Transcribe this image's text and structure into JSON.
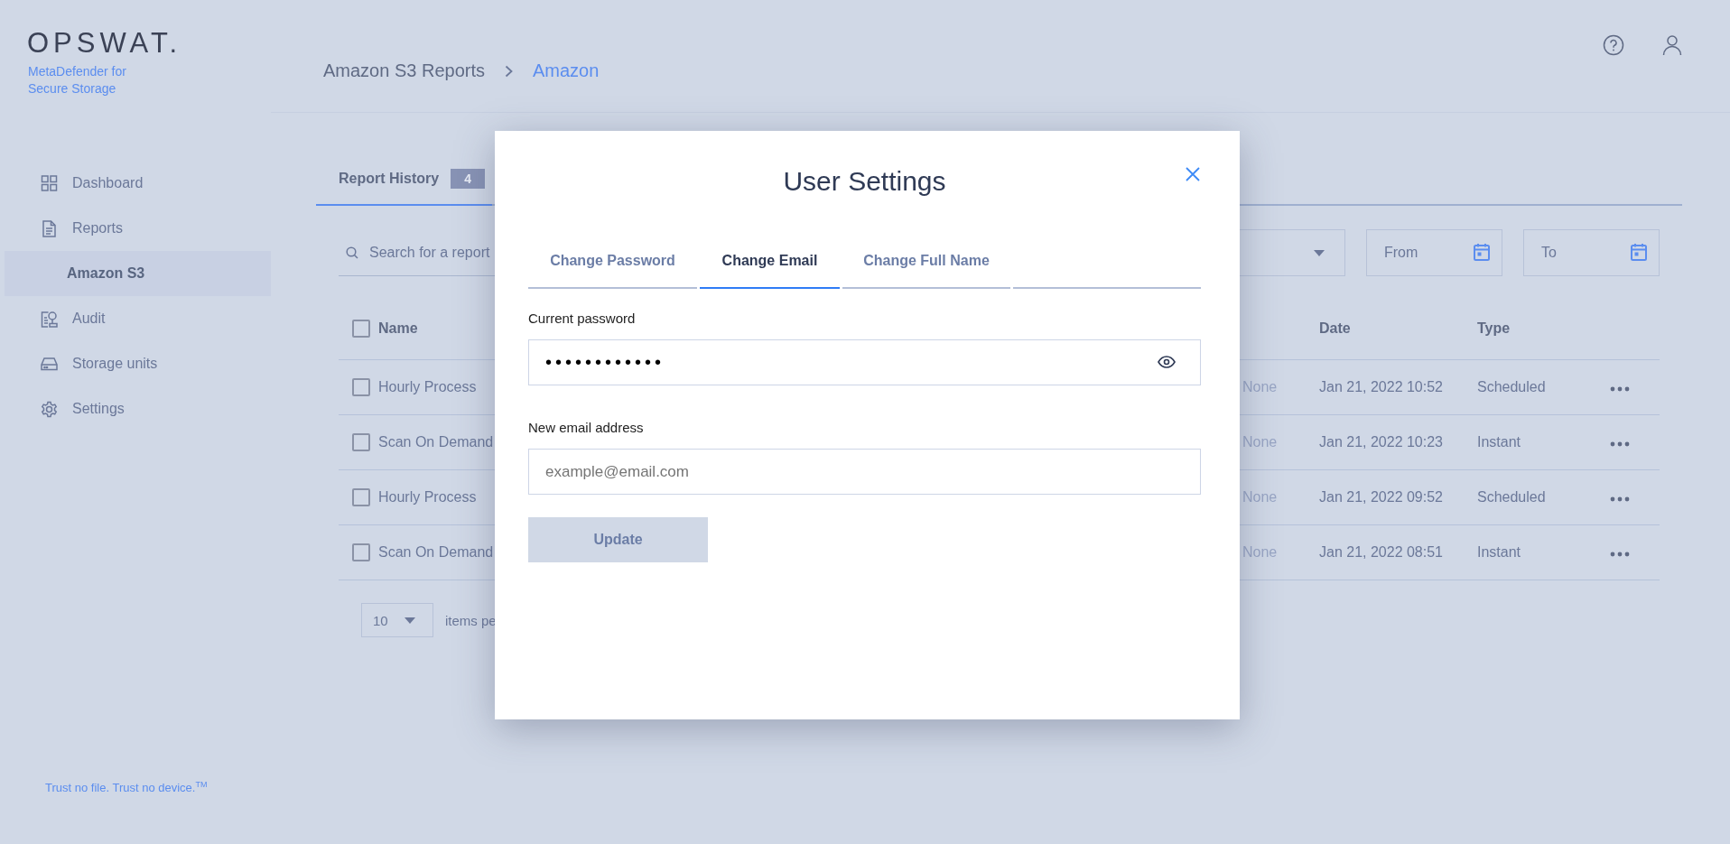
{
  "brand": {
    "logo": "OPSWAT.",
    "product": "MetaDefender for Secure Storage"
  },
  "sidebar": {
    "items": [
      {
        "label": "Dashboard",
        "selected": false
      },
      {
        "label": "Reports",
        "selected": false,
        "children": [
          {
            "label": "Amazon S3",
            "selected": true
          }
        ]
      },
      {
        "label": "Audit",
        "selected": false
      },
      {
        "label": "Storage units",
        "selected": false
      },
      {
        "label": "Settings",
        "selected": false
      }
    ],
    "tagline": "Trust no file. Trust no device.$^{TM}$"
  },
  "breadcrumb": [
    "Amazon S3 Reports",
    "Amazon"
  ],
  "tabs": [
    {
      "label": "Report History",
      "count": "4",
      "selected": true
    }
  ],
  "search": {
    "placeholder": "Search for a report"
  },
  "filters": {
    "from": {
      "placeholder": "From"
    },
    "to": {
      "placeholder": "To"
    }
  },
  "table": {
    "columns": {
      "name": "Name",
      "date": "Date",
      "type": "Type"
    },
    "select_all_checked": false,
    "rows": [
      {
        "checked": false,
        "name": "Hourly Process",
        "column_2": "None",
        "date": "Jan 21, 2022 10:52",
        "type": "Scheduled"
      },
      {
        "checked": false,
        "name": "Scan On Demand",
        "column_2": "None",
        "date": "Jan 21, 2022 10:23",
        "type": "Instant"
      },
      {
        "checked": false,
        "name": "Hourly Process",
        "column_2": "None",
        "date": "Jan 21, 2022 09:52",
        "type": "Scheduled"
      },
      {
        "checked": false,
        "name": "Scan On Demand",
        "column_2": "None",
        "date": "Jan 21, 2022 08:51",
        "type": "Instant"
      }
    ]
  },
  "pagination": {
    "page_size": "10",
    "label": "items pe"
  },
  "dialog": {
    "title": "User Settings",
    "tabs": [
      {
        "label": "Change Password",
        "selected": false
      },
      {
        "label": "Change Email",
        "selected": true
      },
      {
        "label": "Change Full Name",
        "selected": false
      }
    ],
    "fields": [
      {
        "kind": "password",
        "label": "Current password",
        "value": "••••••••••••"
      },
      {
        "kind": "email",
        "label": "New email address",
        "placeholder": "example@email.com"
      }
    ],
    "button": {
      "label": "Update",
      "disabled": true
    }
  }
}
